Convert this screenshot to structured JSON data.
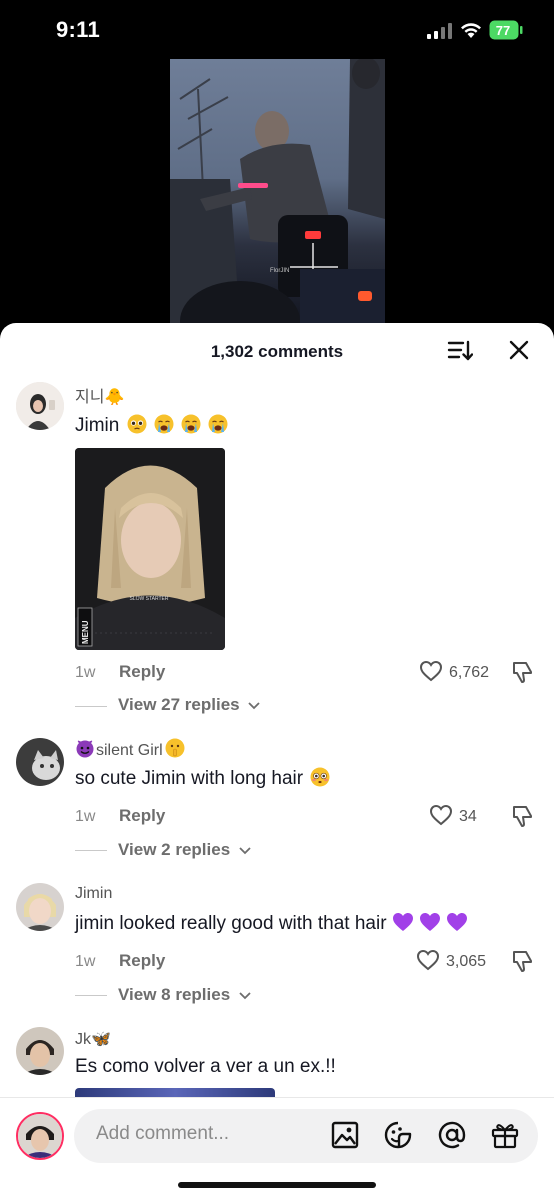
{
  "status_bar": {
    "time": "9:11",
    "battery": "77"
  },
  "sheet": {
    "comment_count": "1,302 comments"
  },
  "comments": [
    {
      "username": "지니🐥",
      "text": "Jimin",
      "time": "1w",
      "reply_label": "Reply",
      "likes": "6,762",
      "view_replies": "View 27 replies",
      "photo_caption": "SLOW STARTER",
      "photo_side_label": "MENU"
    },
    {
      "username": "silent Girl",
      "text": "so cute Jimin with long hair",
      "time": "1w",
      "reply_label": "Reply",
      "likes": "34",
      "view_replies": "View 2 replies"
    },
    {
      "username": "Jimin",
      "text": "jimin looked really good with that hair",
      "time": "1w",
      "reply_label": "Reply",
      "likes": "3,065",
      "view_replies": "View 8 replies"
    },
    {
      "username": "Jk🦋",
      "text": "Es como volver a ver a un ex.!!"
    }
  ],
  "video": {
    "watermark": "FlorJIN"
  },
  "input": {
    "placeholder": "Add comment..."
  },
  "colors": {
    "accent": "#fe2c55",
    "battery": "#4cd964"
  }
}
